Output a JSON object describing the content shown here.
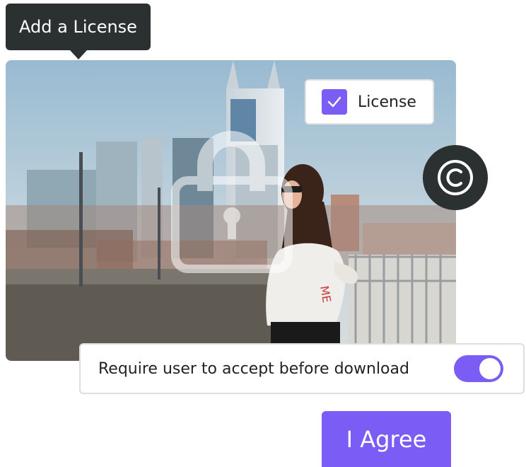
{
  "tooltip": {
    "label": "Add a License"
  },
  "license_chip": {
    "label": "License",
    "checked": true,
    "icon": "check-icon"
  },
  "copyright_badge": {
    "icon": "copyright-icon"
  },
  "photo": {
    "overlay_icon": "lock-icon"
  },
  "accept_setting": {
    "label": "Require user to accept before download",
    "toggle_on": true
  },
  "agree_button": {
    "label": "I Agree"
  },
  "colors": {
    "accent": "#7b5cf4",
    "dark": "#2b3031",
    "text": "#1f2223"
  }
}
